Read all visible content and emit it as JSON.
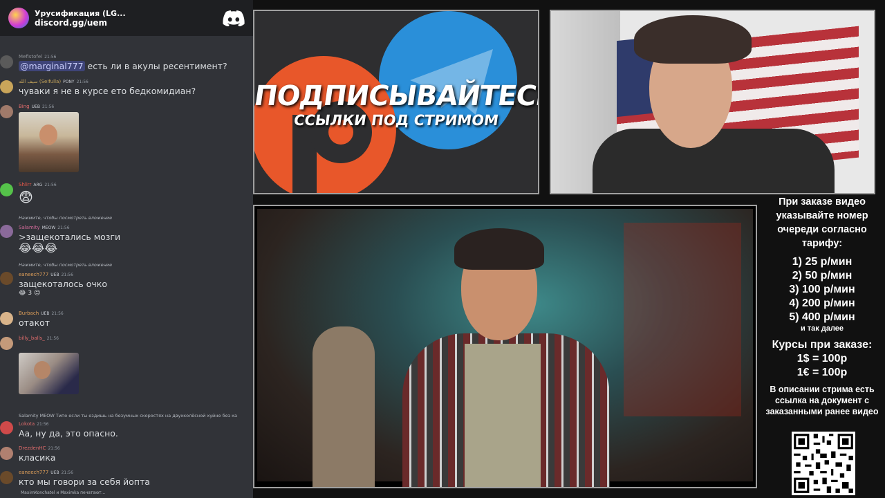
{
  "chat": {
    "server_name": "Урусификация (LG...",
    "server_invite": "discord.gg/uem",
    "messages": [
      {
        "user": "Mefistofel",
        "time": "21:56",
        "mention": "@marginal777",
        "text": " есть ли в акулы ресентимент?"
      },
      {
        "user": "سيف الله (Seifulla)",
        "badge": "PONY",
        "time": "21:56",
        "text": "чуваки я не в курсе ето бедкомидиан?"
      },
      {
        "user": "Bing",
        "badge": "UEB",
        "time": "21:56"
      },
      {
        "user": "Shlirr",
        "badge": "ARG",
        "time": "21:56",
        "emoji": "😨"
      },
      {
        "reply": "Нажмите, чтобы посмотреть вложение",
        "user": "Salamity",
        "badge": "MEOW",
        "time": "21:56",
        "text": ">защекотались мозги",
        "emoji": "😂😂😂"
      },
      {
        "reply": "Нажмите, чтобы посмотреть вложение",
        "user": "eaneech777",
        "badge": "UEB",
        "time": "21:56",
        "text": "защекоталось очко",
        "reactions": "😂 3   ☺"
      },
      {
        "user": "Burbach",
        "badge": "UEB",
        "time": "21:56",
        "text": "отакот"
      },
      {
        "user": "billy_balls_",
        "time": "21:56"
      },
      {
        "reply": "Salamity  MEOW  Типо если ты ездишь на безумных скоростях на двухколёсной хуйне без ка",
        "user": "Lokota",
        "time": "21:56",
        "text": "Аа, ну да, это опасно."
      },
      {
        "user": "DrezdenHC",
        "time": "21:56",
        "text": "класика"
      },
      {
        "user": "eaneech777",
        "badge": "UEB",
        "time": "21:56",
        "text": "кто мы говори за себя йопта"
      }
    ],
    "typing": "MaximKonchatel и Maximka печатают..."
  },
  "promo": {
    "title": "ПОДПИСЫВАЙТЕСЬ",
    "subtitle": "ССЫЛКИ ПОД СТРИМОМ"
  },
  "info": {
    "header": "При заказе видео указывайте номер очереди согласно тарифу:",
    "tariffs": [
      "1) 25 р/мин",
      "2) 50 р/мин",
      "3) 100 р/мин",
      "4) 200 р/мин",
      "5) 400 р/мин"
    ],
    "etc": "и так далее",
    "rates_title": "Курсы при заказе:",
    "rates": [
      "1$ = 100р",
      "1€ = 100р"
    ],
    "note": "В описании стрима есть ссылка на документ с заказанными ранее видео"
  },
  "colors": {
    "discord_bg": "#313338",
    "accent_red": "#e8572a",
    "telegram_blue": "#2a8fd9"
  }
}
